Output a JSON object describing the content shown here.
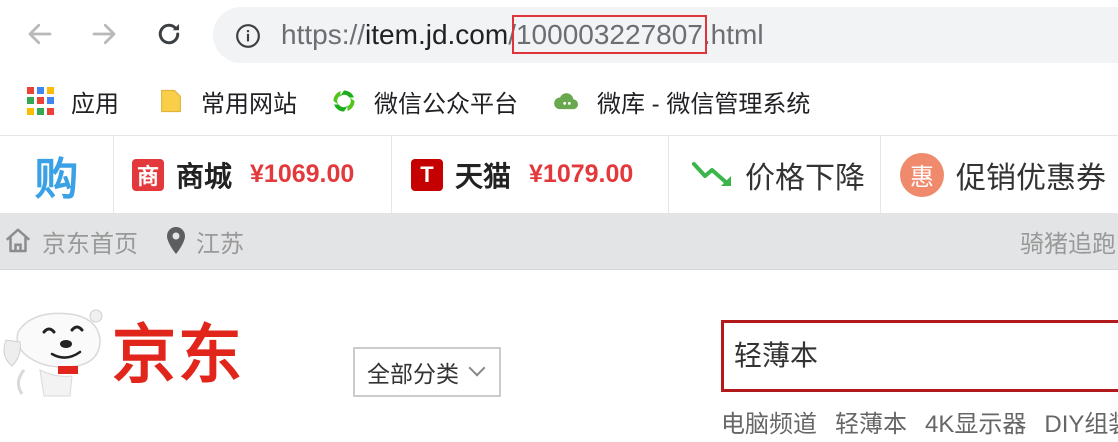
{
  "browser": {
    "url_prefix": "https://",
    "url_host": "item.jd.com",
    "url_slash": "/",
    "url_product_id": "100003227807",
    "url_suffix": ".html",
    "bookmarks": [
      {
        "icon": "apps-grid-icon",
        "label": "应用"
      },
      {
        "icon": "folder-icon",
        "label": "常用网站"
      },
      {
        "icon": "wechat-mp-icon",
        "label": "微信公众平台"
      },
      {
        "icon": "weiku-cloud-icon",
        "label": "微库 - 微信管理系统"
      }
    ]
  },
  "price_extension": {
    "logo_glyph": "购",
    "stores": [
      {
        "badge": "商",
        "badge_color": "#e4393c",
        "name": "商城",
        "price": "¥1069.00"
      },
      {
        "badge": "T",
        "badge_color": "#c40000",
        "name": "天猫",
        "price": "¥1079.00"
      }
    ],
    "price_drop_label": "价格下降",
    "coupon_badge": "惠",
    "coupon_label": "促销优惠券"
  },
  "shortcut": {
    "home": "京东首页",
    "location": "江苏",
    "right_text": "骑猪追跑"
  },
  "header": {
    "logo_text": "京东",
    "category_select": "全部分类",
    "search_value": "轻薄本",
    "hotwords": [
      "电脑频道",
      "轻薄本",
      "4K显示器",
      "DIY组装"
    ]
  },
  "colors": {
    "jd_red": "#e1251b",
    "price_red": "#e4393c",
    "search_border": "#b1191a",
    "url_highlight": "#e0343b"
  }
}
